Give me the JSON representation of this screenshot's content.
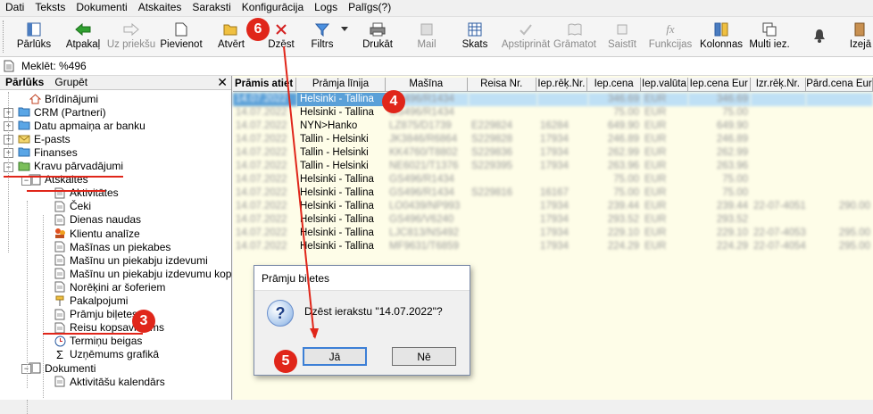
{
  "menu": [
    "Dati",
    "Teksts",
    "Dokumenti",
    "Atskaites",
    "Saraksti",
    "Konfigurācija",
    "Logs",
    "Palīgs(?)"
  ],
  "toolbar": {
    "items": [
      {
        "label": "Pārlūks",
        "icon": "browser-panel-icon",
        "enabled": true
      },
      {
        "label": "Atpakaļ",
        "icon": "back-arrow-icon",
        "enabled": true
      },
      {
        "label": "Uz priekšu",
        "icon": "forward-arrow-icon",
        "enabled": false
      },
      {
        "label": "Pievienot",
        "icon": "new-document-icon",
        "enabled": true
      },
      {
        "label": "Atvērt",
        "icon": "open-folder-icon",
        "enabled": true
      },
      {
        "label": "Dzēst",
        "icon": "delete-x-icon",
        "enabled": true
      },
      {
        "label": "Filtrs",
        "icon": "filter-funnel-icon",
        "enabled": true
      },
      {
        "label": "Drukāt",
        "icon": "printer-icon",
        "enabled": true
      },
      {
        "label": "Mail",
        "icon": "mail-icon",
        "enabled": false
      },
      {
        "label": "Skats",
        "icon": "grid-view-icon",
        "enabled": true
      },
      {
        "label": "Apstiprināt",
        "icon": "approve-icon",
        "enabled": false
      },
      {
        "label": "Grāmatot",
        "icon": "book-icon",
        "enabled": false
      },
      {
        "label": "Saistīt",
        "icon": "link-icon",
        "enabled": false
      },
      {
        "label": "Funkcijas",
        "icon": "function-icon",
        "enabled": false
      },
      {
        "label": "Kolonnas",
        "icon": "columns-icon",
        "enabled": true
      },
      {
        "label": "Multi iez.",
        "icon": "multi-icon",
        "enabled": true
      },
      {
        "label": "",
        "icon": "bell-icon",
        "enabled": true
      },
      {
        "label": "Izejā",
        "icon": "exit-icon",
        "enabled": true
      }
    ]
  },
  "search": {
    "text": "Meklēt: %496"
  },
  "left_panel": {
    "tabs": [
      "Pārlūks",
      "Grupēt"
    ],
    "tree": [
      {
        "label": "Brīdinājumi",
        "level": 1,
        "icon": "home-icon"
      },
      {
        "label": "CRM (Partneri)",
        "level": 0,
        "icon": "folder-icon",
        "exp": "+"
      },
      {
        "label": "Datu apmaiņa ar banku",
        "level": 0,
        "icon": "folder-icon",
        "exp": "+"
      },
      {
        "label": "E-pasts",
        "level": 0,
        "icon": "envelope-icon",
        "exp": "+"
      },
      {
        "label": "Finanses",
        "level": 0,
        "icon": "folder-icon",
        "exp": "+"
      },
      {
        "label": "Kravu pārvadājumi",
        "level": 0,
        "icon": "folder-open-icon",
        "exp": "−"
      },
      {
        "label": "Atskaites",
        "level": 1,
        "icon": "report-icon",
        "exp": "−"
      },
      {
        "label": "Aktivitātes",
        "level": 2,
        "icon": "document-icon"
      },
      {
        "label": "Čeki",
        "level": 2,
        "icon": "document-icon"
      },
      {
        "label": "Dienas naudas",
        "level": 2,
        "icon": "document-icon"
      },
      {
        "label": "Klientu analīze",
        "level": 2,
        "icon": "people-icon"
      },
      {
        "label": "Mašīnas un piekabes",
        "level": 2,
        "icon": "document-icon"
      },
      {
        "label": "Mašīnu un piekabju izdevumi",
        "level": 2,
        "icon": "document-icon"
      },
      {
        "label": "Mašīnu un piekabju izdevumu kop",
        "level": 2,
        "icon": "document-icon"
      },
      {
        "label": "Norēķini ar šoferiem",
        "level": 2,
        "icon": "document-icon"
      },
      {
        "label": "Pakalpojumi",
        "level": 2,
        "icon": "pin-icon"
      },
      {
        "label": "Prāmju biļetes",
        "level": 2,
        "icon": "document-icon"
      },
      {
        "label": "Reisu kopsavilkums",
        "level": 2,
        "icon": "document-icon"
      },
      {
        "label": "Termiņu beigas",
        "level": 2,
        "icon": "clock-icon"
      },
      {
        "label": "Uzņēmums grafikā",
        "level": 2,
        "icon": "sigma-icon"
      },
      {
        "label": "Dokumenti",
        "level": 1,
        "icon": "report-icon",
        "exp": "−"
      },
      {
        "label": "Aktivitāšu kalendārs",
        "level": 2,
        "icon": "document-icon"
      }
    ]
  },
  "grid": {
    "columns": [
      "Prāmis atiet",
      "Prāmja līnija",
      "Mašīna",
      "Reisa Nr.",
      "Iep.rēķ.Nr.",
      "Iep.cena",
      "Iep.valūta",
      "Iep.cena Eur",
      "Izr.rēķ.Nr.",
      "Pārd.cena Eur"
    ],
    "rows": [
      [
        "14.07.2022",
        "Helsinki - Tallina",
        "GS496/R1434",
        "",
        "",
        "346.69",
        "EUR",
        "346.69",
        "",
        ""
      ],
      [
        "14.07.2022",
        "Helsinki - Tallina",
        "GS496/R1434",
        "",
        "",
        "75.00",
        "EUR",
        "75.00",
        "",
        ""
      ],
      [
        "14.07.2022",
        "NYN>Hanko",
        "LZ875/D1739",
        "E229824",
        "16284",
        "649.90",
        "EUR",
        "649.90",
        "",
        ""
      ],
      [
        "14.07.2022",
        "Tallin - Helsinki",
        "JK3846/R6864",
        "S229828",
        "17934",
        "246.89",
        "EUR",
        "246.89",
        "",
        ""
      ],
      [
        "14.07.2022",
        "Tallin - Helsinki",
        "KK4760/T8802",
        "S229836",
        "17934",
        "262.99",
        "EUR",
        "262.99",
        "",
        ""
      ],
      [
        "14.07.2022",
        "Tallin - Helsinki",
        "NE6021/T1376",
        "S229395",
        "17934",
        "263.96",
        "EUR",
        "263.96",
        "",
        ""
      ],
      [
        "14.07.2022",
        "Helsinki - Tallina",
        "GS496/R1434",
        "",
        "",
        "75.00",
        "EUR",
        "75.00",
        "",
        ""
      ],
      [
        "14.07.2022",
        "Helsinki - Tallina",
        "GS496/R1434",
        "S229816",
        "16167",
        "75.00",
        "EUR",
        "75.00",
        "",
        ""
      ],
      [
        "14.07.2022",
        "Helsinki - Tallina",
        "LO0439/NP993",
        "",
        "17934",
        "239.44",
        "EUR",
        "239.44",
        "22-07-4051",
        "290.00"
      ],
      [
        "14.07.2022",
        "Helsinki - Tallina",
        "GS496/V6240",
        "",
        "17934",
        "293.52",
        "EUR",
        "293.52",
        "",
        ""
      ],
      [
        "14.07.2022",
        "Helsinki - Tallina",
        "LJC813/NS492",
        "",
        "17934",
        "229.10",
        "EUR",
        "229.10",
        "22-07-4053",
        "295.00"
      ],
      [
        "14.07.2022",
        "Helsinki - Tallina",
        "MF9631/T6859",
        "",
        "17934",
        "224.29",
        "EUR",
        "224.29",
        "22-07-4054",
        "295.00"
      ]
    ]
  },
  "dialog": {
    "title": "Prāmju biļetes",
    "message": "Dzēst ierakstu \"14.07.2022\"?",
    "yes_label": "Jā",
    "no_label": "Nē"
  },
  "annotations": [
    "3",
    "4",
    "5",
    "6"
  ]
}
